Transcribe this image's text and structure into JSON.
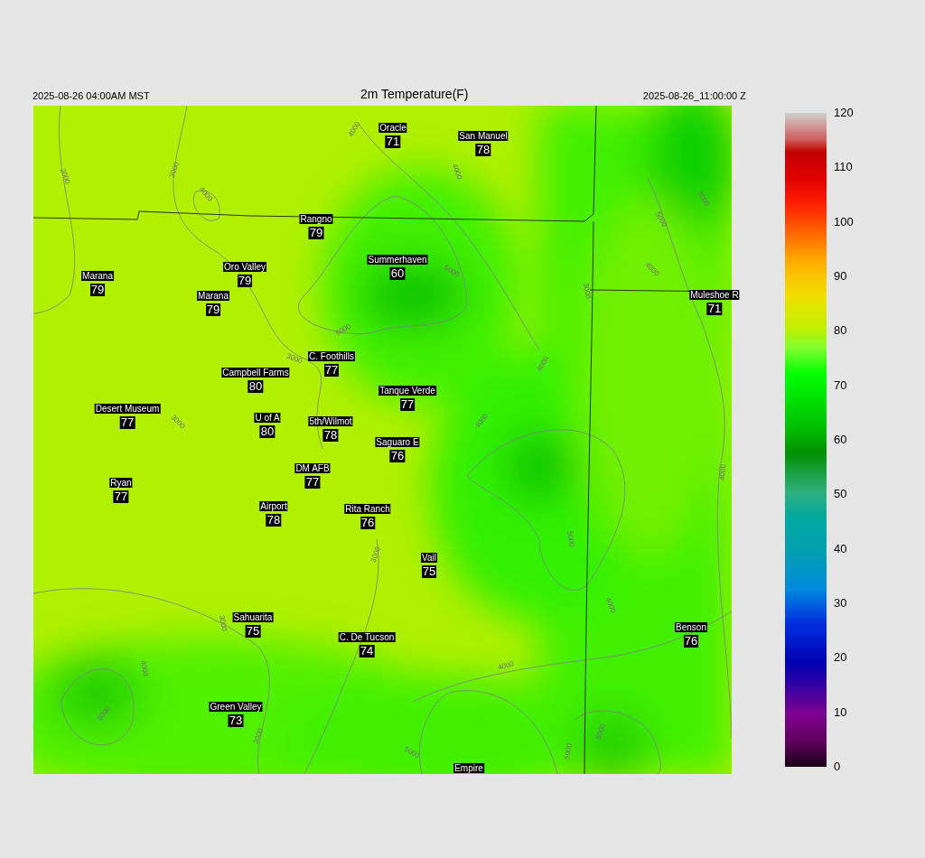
{
  "header": {
    "valid_time": "2025-08-26 04:00AM MST",
    "title": "2m Temperature(F)",
    "model_time": "2025-08-26_11:00:00 Z"
  },
  "stations": [
    {
      "name": "Oracle",
      "value": "71"
    },
    {
      "name": "San Manuel",
      "value": "78"
    },
    {
      "name": "Rangno",
      "value": "79"
    },
    {
      "name": "Summerhaven",
      "value": "60"
    },
    {
      "name": "Marana",
      "value": "79"
    },
    {
      "name": "Oro Valley",
      "value": "79"
    },
    {
      "name": "Marana",
      "value": "79"
    },
    {
      "name": "Muleshoe R",
      "value": "71"
    },
    {
      "name": "C. Foothills",
      "value": "77"
    },
    {
      "name": "Campbell Farms",
      "value": "80"
    },
    {
      "name": "Tanque Verde",
      "value": "77"
    },
    {
      "name": "Desert Museum",
      "value": "77"
    },
    {
      "name": "U of A",
      "value": "80"
    },
    {
      "name": "5th/Wilmot",
      "value": "78"
    },
    {
      "name": "Saguaro E",
      "value": "76"
    },
    {
      "name": "DM AFB",
      "value": "77"
    },
    {
      "name": "Ryan",
      "value": "77"
    },
    {
      "name": "Airport",
      "value": "78"
    },
    {
      "name": "Rita Ranch",
      "value": "76"
    },
    {
      "name": "Vail",
      "value": "75"
    },
    {
      "name": "Sahuarita",
      "value": "75"
    },
    {
      "name": "Benson",
      "value": "76"
    },
    {
      "name": "C. De Tucson",
      "value": "74"
    },
    {
      "name": "Green Valley",
      "value": "73"
    },
    {
      "name": "Empire"
    }
  ],
  "contour_labels": [
    "2000",
    "3000",
    "4000",
    "4000",
    "4000",
    "5000",
    "5000",
    "4000",
    "3000",
    "5000",
    "6000",
    "3000",
    "3000",
    "4000",
    "4000",
    "5000",
    "3000",
    "4000",
    "3000",
    "4000",
    "5000",
    "4000",
    "3000",
    "5000",
    "5000",
    "5000",
    "4000"
  ],
  "colorbar": {
    "ticks": [
      "120",
      "110",
      "100",
      "90",
      "80",
      "70",
      "60",
      "50",
      "40",
      "30",
      "20",
      "10",
      "0"
    ]
  }
}
